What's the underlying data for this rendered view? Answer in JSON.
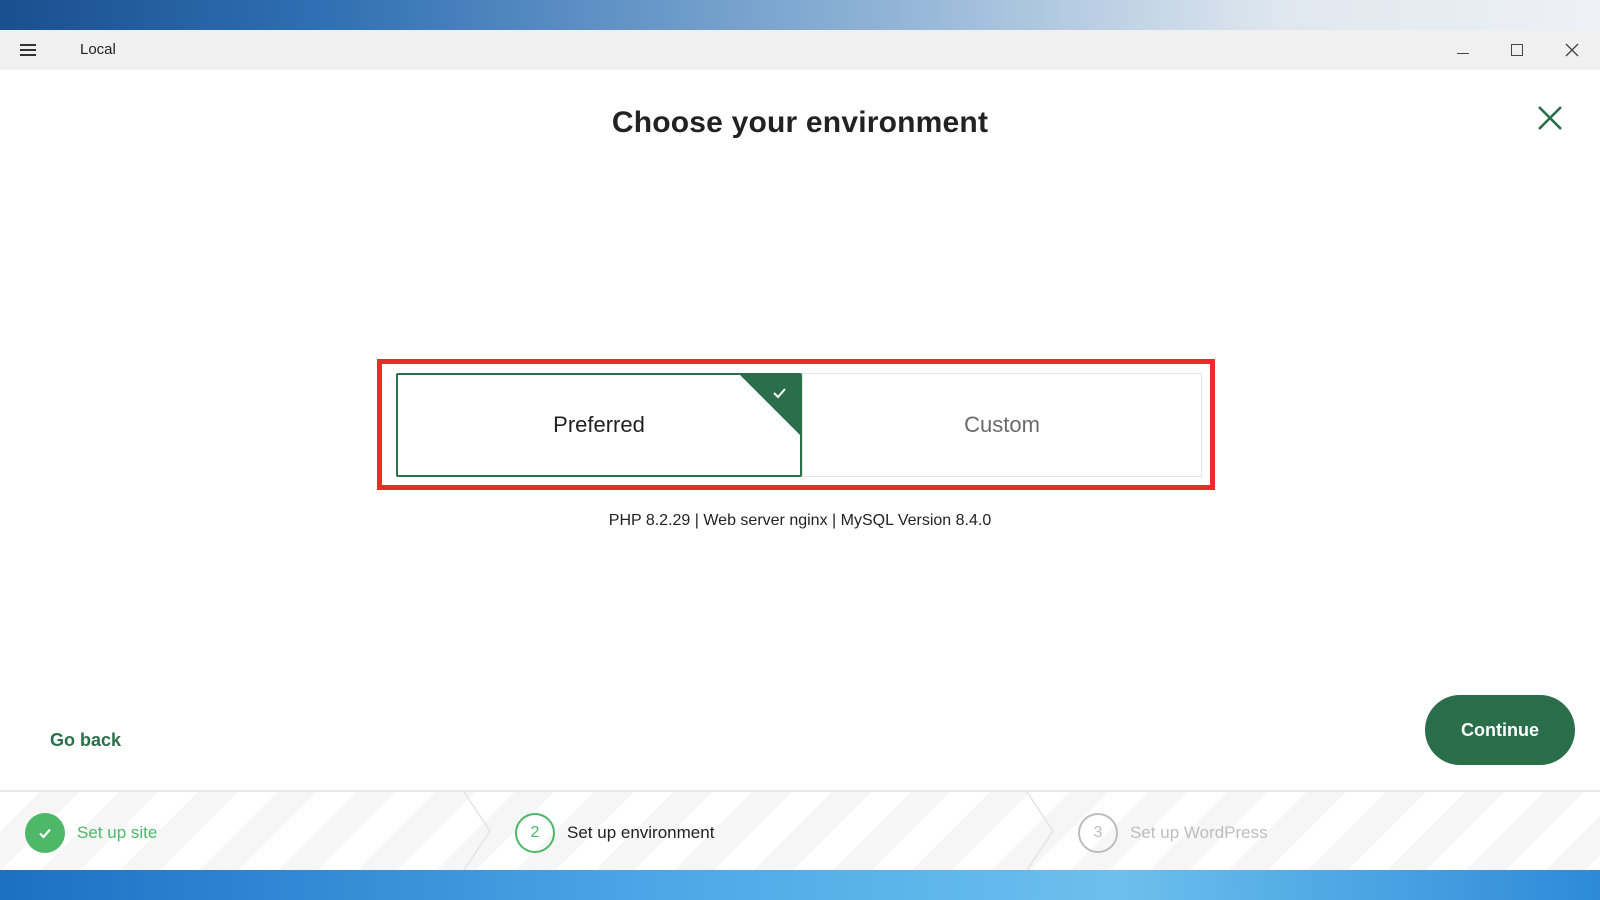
{
  "window": {
    "title": "Local"
  },
  "dialog": {
    "title": "Choose your environment",
    "options": [
      {
        "label": "Preferred",
        "selected": true
      },
      {
        "label": "Custom",
        "selected": false
      }
    ],
    "environment_info": "PHP 8.2.29 | Web server nginx | MySQL Version 8.4.0",
    "go_back_label": "Go back",
    "continue_label": "Continue"
  },
  "steps": [
    {
      "number": "1",
      "label": "Set up site",
      "state": "complete"
    },
    {
      "number": "2",
      "label": "Set up environment",
      "state": "active"
    },
    {
      "number": "3",
      "label": "Set up WordPress",
      "state": "pending"
    }
  ],
  "colors": {
    "brand_green": "#2b6e4a",
    "step_green": "#4cb868",
    "highlight_red": "#ee2b2b",
    "inactive_gray": "#bdbdbd"
  }
}
